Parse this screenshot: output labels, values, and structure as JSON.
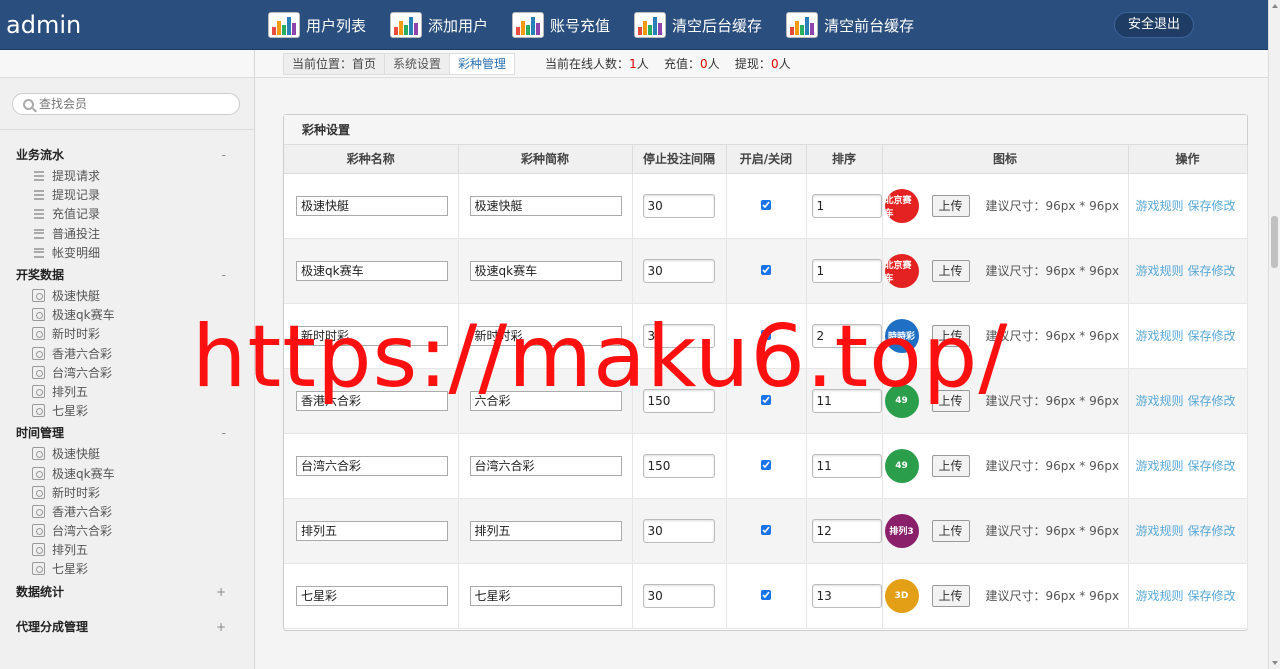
{
  "app": {
    "brand": "admin"
  },
  "nav": {
    "items": [
      {
        "label": "用户列表",
        "icon": "chart-icon"
      },
      {
        "label": "添加用户",
        "icon": "chart-icon"
      },
      {
        "label": "账号充值",
        "icon": "chart-icon"
      },
      {
        "label": "清空后台缓存",
        "icon": "chart-icon"
      },
      {
        "label": "清空前台缓存",
        "icon": "chart-icon"
      }
    ],
    "logout": "安全退出"
  },
  "sidebar": {
    "search_placeholder": "查找会员",
    "groups": [
      {
        "title": "业务流水",
        "toggle": "-",
        "items": [
          "提现请求",
          "提现记录",
          "充值记录",
          "普通投注",
          "帐变明细"
        ]
      },
      {
        "title": "开奖数据",
        "toggle": "-",
        "items": [
          "极速快艇",
          "极速qk赛车",
          "新时时彩",
          "香港六合彩",
          "台湾六合彩",
          "排列五",
          "七星彩"
        ]
      },
      {
        "title": "时间管理",
        "toggle": "-",
        "items": [
          "极速快艇",
          "极速qk赛车",
          "新时时彩",
          "香港六合彩",
          "台湾六合彩",
          "排列五",
          "七星彩"
        ]
      },
      {
        "title": "数据统计",
        "toggle": "+",
        "items": []
      },
      {
        "title": "代理分成管理",
        "toggle": "+",
        "items": []
      }
    ]
  },
  "breadcrumb": {
    "items": [
      "当前位置：首页",
      "系统设置",
      "彩种管理"
    ],
    "online_label": "当前在线人数：",
    "online_count": "1",
    "recharge_label": "充值：",
    "recharge_count": "0",
    "withdraw_label": "提现：",
    "withdraw_count": "0",
    "unit": "人"
  },
  "panel": {
    "title": "彩种设置",
    "columns": [
      "彩种名称",
      "彩种简称",
      "停止投注间隔",
      "开启/关闭",
      "排序",
      "图标",
      "操作"
    ],
    "upload_label": "上传",
    "size_note": "建议尺寸：96px * 96px",
    "op_rules": "游戏规则",
    "op_save": "保存修改",
    "rows": [
      {
        "name": "极速快艇",
        "short": "极速快艇",
        "interval": "30",
        "enabled": true,
        "order": "1",
        "icon_text": "北京赛车",
        "icon_color": "#e52222"
      },
      {
        "name": "极速qk赛车",
        "short": "极速qk赛车",
        "interval": "30",
        "enabled": true,
        "order": "1",
        "icon_text": "北京赛车",
        "icon_color": "#e52222"
      },
      {
        "name": "新时时彩",
        "short": "新时时彩",
        "interval": "30",
        "enabled": true,
        "order": "2",
        "icon_text": "時時彩",
        "icon_color": "#1f6fc4"
      },
      {
        "name": "香港六合彩",
        "short": "六合彩",
        "interval": "150",
        "enabled": true,
        "order": "11",
        "icon_text": "49",
        "icon_color": "#2a9e4b"
      },
      {
        "name": "台湾六合彩",
        "short": "台湾六合彩",
        "interval": "150",
        "enabled": true,
        "order": "11",
        "icon_text": "49",
        "icon_color": "#2a9e4b"
      },
      {
        "name": "排列五",
        "short": "排列五",
        "interval": "30",
        "enabled": true,
        "order": "12",
        "icon_text": "排列3",
        "icon_color": "#8a1f6a"
      },
      {
        "name": "七星彩",
        "short": "七星彩",
        "interval": "30",
        "enabled": true,
        "order": "13",
        "icon_text": "3D",
        "icon_color": "#e3a017"
      }
    ]
  },
  "watermark": "https://maku6.top/"
}
